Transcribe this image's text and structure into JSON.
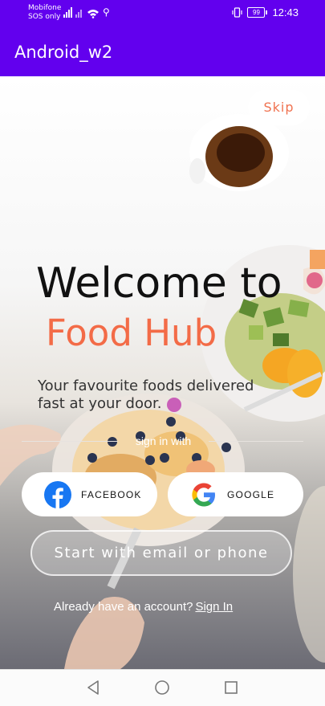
{
  "status_bar": {
    "carrier_line1": "Mobifone",
    "carrier_line2": "SOS only",
    "battery": "99",
    "time": "12:43"
  },
  "app_bar": {
    "title": "Android_w2"
  },
  "onboarding": {
    "skip_label": "Skip",
    "welcome_title": "Welcome to",
    "brand_name": "Food Hub",
    "tagline": "Your favourite foods delivered fast at your door.",
    "divider_text": "sign in with",
    "facebook_label": "FACEBOOK",
    "google_label": "GOOGLE",
    "email_button_label": "Start with email or phone",
    "already_text": "Already have an account?",
    "signin_link": "Sign In"
  },
  "colors": {
    "app_bar": "#6200EE",
    "accent": "#F36B47",
    "facebook": "#1877F2"
  },
  "icons": [
    "facebook-icon",
    "google-icon",
    "back-icon",
    "home-icon",
    "recents-icon"
  ]
}
